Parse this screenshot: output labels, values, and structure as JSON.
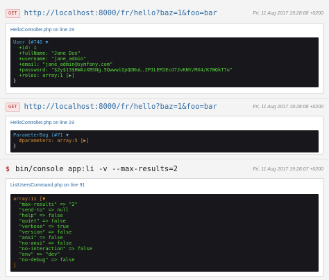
{
  "dumps": [
    {
      "method": "GET",
      "url": "http://localhost:8000/fr/hello?baz=1&foo=bar",
      "date": "Fri, 11 Aug 2017 19:28:08 +0200",
      "file": "HelloController.php on line 19",
      "lines": [
        [
          "User {#746 ▼"
        ],
        [
          "  +id: 1"
        ],
        [
          "  +fullName: \"Jane Doe\""
        ],
        [
          "  +username: \"jane_admin\""
        ],
        [
          "  +email: \"jane_admin@symfony.com\""
        ],
        [
          "  +password: \"$2y$13$HWAzXBSNg.5QwwwiIpQDBuL.ZPILEM1Ecd7JvKNY/MX4/K7WQkT7u\""
        ],
        [
          "  +roles: array:1 [▶]"
        ],
        [
          "}"
        ]
      ]
    },
    {
      "method": "GET",
      "url": "http://localhost:8000/fr/hello?baz=1&foo=bar",
      "date": "Fri, 11 Aug 2017 19:28:08 +0200",
      "file": "HelloController.php on line 19",
      "lines": [
        [
          "ParameterBag {#71 ▼"
        ],
        [
          "  #parameters: array:5 [▶]"
        ],
        [
          "}"
        ]
      ]
    },
    {
      "prompt": "$",
      "command": "bin/console app:li -v --max-results=2",
      "date": "Fri, 11 Aug 2017 19:28:07 +0200",
      "file": "ListUsersCommand.php on line 91",
      "lines": [
        [
          "array:11 [▼"
        ],
        [
          "  \"max-results\" => \"2\""
        ],
        [
          "  \"send-to\" => null"
        ],
        [
          "  \"help\" => false"
        ],
        [
          "  \"quiet\" => false"
        ],
        [
          "  \"verbose\" => true"
        ],
        [
          "  \"version\" => false"
        ],
        [
          "  \"ansi\" => false"
        ],
        [
          "  \"no-ansi\" => false"
        ],
        [
          "  \"no-interaction\" => false"
        ],
        [
          "  \"env\" => \"dev\""
        ],
        [
          "  \"no-debug\" => false"
        ],
        [
          "]"
        ]
      ]
    }
  ],
  "colors": {
    "background": "#f4f4f4",
    "dump_background": "#18171b",
    "url_blue": "#2f6aa1",
    "string_green": "#56db3a",
    "literal_orange": "#ff8400",
    "method_red": "#b0413e"
  }
}
